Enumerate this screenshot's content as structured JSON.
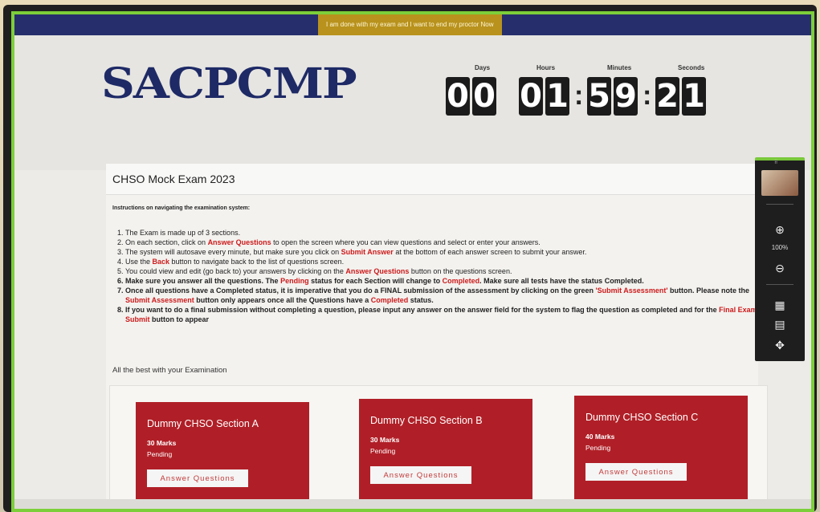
{
  "topbar": {
    "end_proctor_label": "I am done with my exam and I want to end my proctor Now"
  },
  "header": {
    "logo_text": "SACPCMP"
  },
  "timer": {
    "labels": [
      "Days",
      "Hours",
      "Minutes",
      "Seconds"
    ],
    "digits": [
      "0",
      "0",
      "0",
      "1",
      "5",
      "9",
      "2",
      "1"
    ]
  },
  "exam": {
    "title": "CHSO Mock Exam 2023",
    "instructions_heading": "Instructions on navigating the examination system:",
    "instructions": [
      [
        "The Exam is made up of 3 sections."
      ],
      [
        "On each section, click on ",
        {
          "r": "Answer Questions"
        },
        " to open the screen where  you can view questions and select or enter your answers."
      ],
      [
        "The system will autosave every minute, but make sure you click on ",
        {
          "r": "Submit Answer"
        },
        " at the bottom of each answer screen to submit your answer."
      ],
      [
        "Use the ",
        {
          "r": "Back"
        },
        " button to navigate back to the list of questions screen."
      ],
      [
        "You could view and edit (go back to) your answers by clicking on the ",
        {
          "r": "Answer Questions"
        },
        " button on the questions screen."
      ],
      [
        "Make sure you answer all the questions. The ",
        {
          "r": "Pending"
        },
        " status for each Section will change to ",
        {
          "r": "Completed"
        },
        ". Make sure all tests have the status Completed."
      ],
      [
        "Once all questions have a Completed status, it is imperative that you do a FINAL submission of the assessment by clicking on the green ",
        {
          "r": "'Submit Assessment'"
        },
        " button. Please note the ",
        {
          "r": "Submit Assessment"
        },
        " button only appears once all the Questions have a ",
        {
          "r": "Completed"
        },
        " status."
      ],
      [
        "If you want to do a final submission without completing a question, please input any answer on the answer field for the system to flag the question as completed and for the  ",
        {
          "r": "Final Exam Submit"
        },
        " button to appear"
      ]
    ],
    "bold_from_index": 5,
    "closing": "All the best with your Examination"
  },
  "sections": [
    {
      "title": "Dummy CHSO Section A",
      "marks": "30 Marks",
      "status": "Pending",
      "button": "Answer Questions"
    },
    {
      "title": "Dummy CHSO Section B",
      "marks": "30 Marks",
      "status": "Pending",
      "button": "Answer Questions"
    },
    {
      "title": "Dummy CHSO Section C",
      "marks": "40 Marks",
      "status": "Pending",
      "button": "Answer Questions"
    }
  ],
  "side_toolbar": {
    "zoom": "100%",
    "icons": [
      "zoom-in-icon",
      "zoom-out-icon",
      "calculator-icon",
      "chat-icon",
      "move-icon"
    ]
  },
  "colors": {
    "accent_red": "#b01f27",
    "brand_navy": "#1e2a66",
    "border_green": "#7ccf3a",
    "proctor_gold": "#b8921c"
  }
}
